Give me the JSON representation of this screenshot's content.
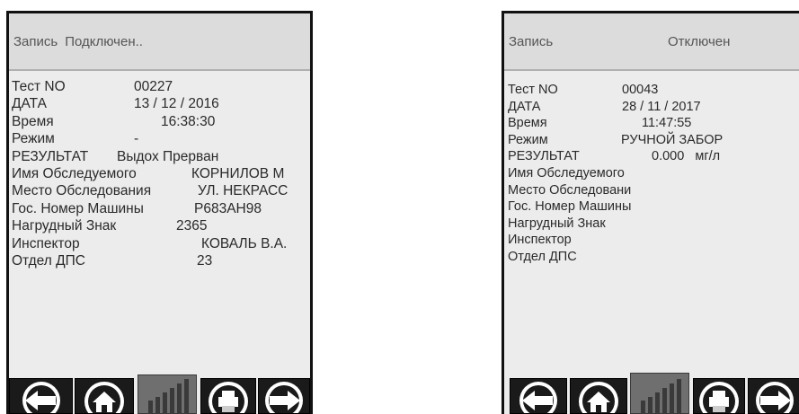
{
  "left": {
    "header": {
      "record_label": "Запись",
      "status": "Подключен.."
    },
    "rows": [
      {
        "key": "Тест NO",
        "value": "00227"
      },
      {
        "key": "ДАТА",
        "value": "13 / 12 / 2016"
      },
      {
        "key": "Время",
        "value": "16:38:30"
      },
      {
        "key": "Режим",
        "value": "-"
      },
      {
        "key": "РЕЗУЛЬТАТ",
        "value": "Выдох Прерван"
      },
      {
        "key": "Имя Обследуемого",
        "value": "КОРНИЛОВ М"
      },
      {
        "key": "Место Обследования",
        "value": "УЛ. НЕКРАСС"
      },
      {
        "key": "Гос. Номер Машины",
        "value": "Р683АН98"
      },
      {
        "key": "Нагрудный Знак",
        "value": "2365"
      },
      {
        "key": "Инспектор",
        "value": "КОВАЛЬ В.А."
      },
      {
        "key": "Отдел ДПС",
        "value": "23"
      }
    ]
  },
  "right": {
    "header": {
      "record_label": "Запись",
      "status": "Отключен"
    },
    "rows": [
      {
        "key": "Тест NO",
        "value": "00043"
      },
      {
        "key": "ДАТА",
        "value": "28 / 11 / 2017"
      },
      {
        "key": "Время",
        "value": "11:47:55"
      },
      {
        "key": "Режим",
        "value": "РУЧНОЙ ЗАБОР"
      },
      {
        "key": "РЕЗУЛЬТАТ",
        "value": "0.000   мг/л"
      },
      {
        "key": "Имя Обследуемого",
        "value": ""
      },
      {
        "key": "Место Обследовани",
        "value": ""
      },
      {
        "key": "Гос. Номер Машины",
        "value": ""
      },
      {
        "key": "Нагрудный Знак",
        "value": ""
      },
      {
        "key": "Инспектор",
        "value": ""
      },
      {
        "key": "Отдел ДПС",
        "value": ""
      }
    ]
  },
  "toolbar_icons": [
    "arrow-left-icon",
    "home-icon",
    "bar-chart-icon",
    "printer-icon",
    "arrow-right-icon"
  ],
  "colors": {
    "screen_bg": "#ececec",
    "header_bg": "#dcdcdc",
    "text": "#2a2a2a",
    "chart_active_bg": "#6f6f6f"
  }
}
